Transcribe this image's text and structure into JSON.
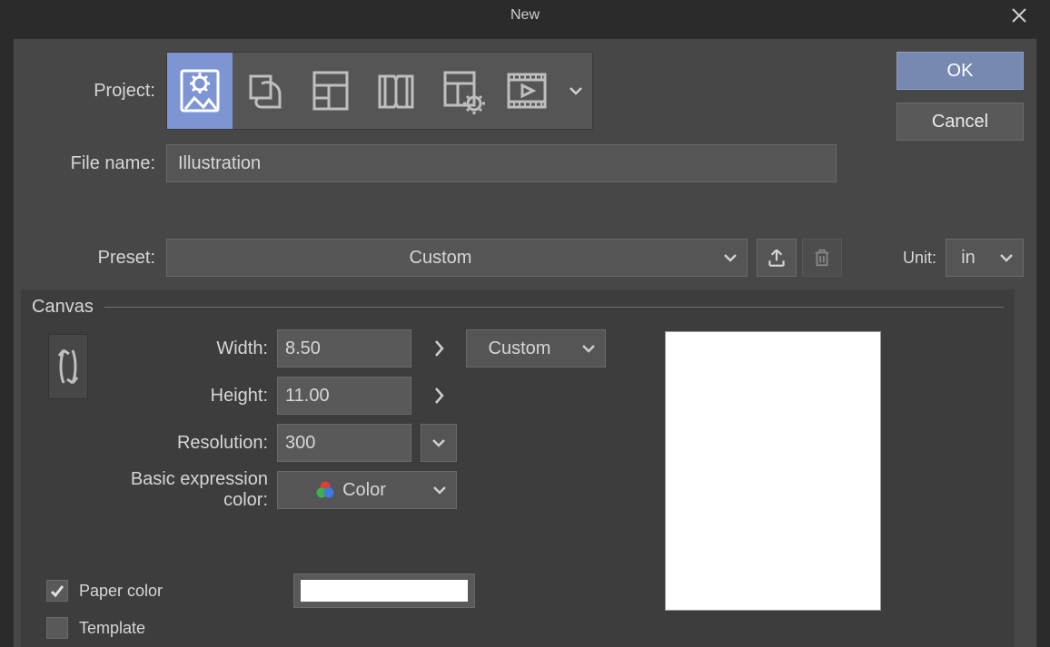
{
  "title": "New",
  "actions": {
    "ok": "OK",
    "cancel": "Cancel"
  },
  "project": {
    "label": "Project:",
    "types": [
      "illustration",
      "webtoon",
      "comic",
      "book",
      "settings",
      "animation"
    ],
    "selected_index": 0
  },
  "filename": {
    "label": "File name:",
    "value": "Illustration"
  },
  "preset": {
    "label": "Preset:",
    "value": "Custom"
  },
  "unit": {
    "label": "Unit:",
    "value": "in"
  },
  "canvas": {
    "group_label": "Canvas",
    "width_label": "Width:",
    "width_value": "8.50",
    "height_label": "Height:",
    "height_value": "11.00",
    "resolution_label": "Resolution:",
    "resolution_value": "300",
    "size_preset": "Custom",
    "color_label": "Basic expression color:",
    "color_value": "Color",
    "paper_label": "Paper color",
    "paper_checked": true,
    "paper_swatch": "#ffffff",
    "template_label": "Template",
    "template_checked": false
  }
}
